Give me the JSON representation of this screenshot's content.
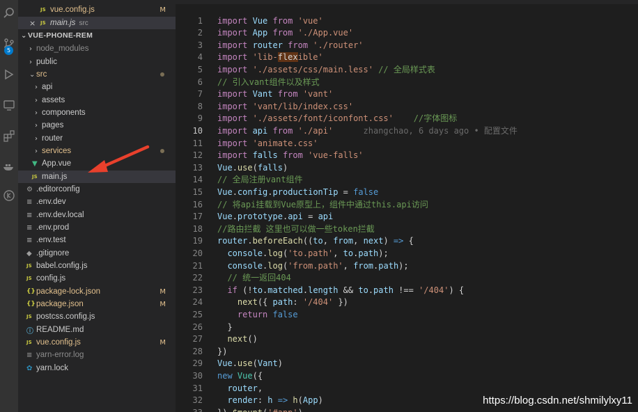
{
  "sidebar": {
    "open_editors": [
      {
        "name": "vue.config.js",
        "badge": "M"
      },
      {
        "name": "main.js",
        "folder": "src",
        "close": "×"
      }
    ],
    "project_title": "VUE-PHONE-REM",
    "tree": [
      {
        "label": "node_modules"
      },
      {
        "label": "public"
      },
      {
        "label": "src"
      },
      {
        "label": "api"
      },
      {
        "label": "assets"
      },
      {
        "label": "components"
      },
      {
        "label": "pages"
      },
      {
        "label": "router"
      },
      {
        "label": "services"
      },
      {
        "label": "App.vue"
      },
      {
        "label": "main.js"
      },
      {
        "label": ".editorconfig"
      },
      {
        "label": ".env.dev"
      },
      {
        "label": ".env.dev.local"
      },
      {
        "label": ".env.prod"
      },
      {
        "label": ".env.test"
      },
      {
        "label": ".gitignore"
      },
      {
        "label": "babel.config.js"
      },
      {
        "label": "config.js"
      },
      {
        "label": "package-lock.json",
        "badge": "M"
      },
      {
        "label": "package.json",
        "badge": "M"
      },
      {
        "label": "postcss.config.js"
      },
      {
        "label": "README.md"
      },
      {
        "label": "vue.config.js",
        "badge": "M"
      },
      {
        "label": "yarn-error.log"
      },
      {
        "label": "yarn.lock"
      }
    ]
  },
  "activity": {
    "badge": "5"
  },
  "editor": {
    "lines": [
      [
        [
          "import ",
          "kw2"
        ],
        [
          "Vue ",
          "id"
        ],
        [
          "from ",
          "kw2"
        ],
        [
          "'vue'",
          "str"
        ]
      ],
      [
        [
          "import ",
          "kw2"
        ],
        [
          "App ",
          "id"
        ],
        [
          "from ",
          "kw2"
        ],
        [
          "'./App.vue'",
          "str"
        ]
      ],
      [
        [
          "import ",
          "kw2"
        ],
        [
          "router ",
          "id"
        ],
        [
          "from ",
          "kw2"
        ],
        [
          "'./router'",
          "str"
        ]
      ],
      [
        [
          "import ",
          "kw2"
        ],
        [
          "'lib-",
          "str"
        ],
        [
          "flex",
          "hl"
        ],
        [
          "ible'",
          "str"
        ]
      ],
      [
        [
          "import ",
          "kw2"
        ],
        [
          "'./assets/css/main.less'",
          "str"
        ],
        [
          " // 全局样式表",
          "cm"
        ]
      ],
      [
        [
          "// 引入vant组件以及样式",
          "cm"
        ]
      ],
      [
        [
          "import ",
          "kw2"
        ],
        [
          "Vant ",
          "id"
        ],
        [
          "from ",
          "kw2"
        ],
        [
          "'vant'",
          "str"
        ]
      ],
      [
        [
          "import ",
          "kw2"
        ],
        [
          "'vant/lib/index.css'",
          "str"
        ]
      ],
      [
        [
          "import ",
          "kw2"
        ],
        [
          "'./assets/font/iconfont.css'",
          "str"
        ],
        [
          "    //字体图标",
          "cm"
        ]
      ],
      [
        [
          "import ",
          "kw2"
        ],
        [
          "api ",
          "id"
        ],
        [
          "from ",
          "kw2"
        ],
        [
          "'./api'",
          "str"
        ],
        [
          "      zhangchao, 6 days ago • 配置文件",
          "blame"
        ]
      ],
      [
        [
          "import ",
          "kw2"
        ],
        [
          "'animate.css'",
          "str"
        ]
      ],
      [
        [
          "import ",
          "kw2"
        ],
        [
          "falls ",
          "id"
        ],
        [
          "from ",
          "kw2"
        ],
        [
          "'vue-falls'",
          "str"
        ]
      ],
      [
        [
          "Vue",
          "id"
        ],
        [
          ".",
          ""
        ],
        [
          "use",
          "fn"
        ],
        [
          "(",
          ""
        ],
        [
          "falls",
          "id"
        ],
        [
          ")",
          ""
        ]
      ],
      [
        [
          "// 全局注册vant组件",
          "cm"
        ]
      ],
      [
        [
          "Vue",
          "id"
        ],
        [
          ".",
          ""
        ],
        [
          "config",
          "id"
        ],
        [
          ".",
          ""
        ],
        [
          "productionTip",
          "id"
        ],
        [
          " = ",
          ""
        ],
        [
          "false",
          "kw"
        ]
      ],
      [
        [
          "// 将api挂载到Vue原型上，组件中通过this.api访问",
          "cm"
        ]
      ],
      [
        [
          "Vue",
          "id"
        ],
        [
          ".",
          ""
        ],
        [
          "prototype",
          "id"
        ],
        [
          ".",
          ""
        ],
        [
          "api",
          "id"
        ],
        [
          " = ",
          ""
        ],
        [
          "api",
          "id"
        ]
      ],
      [
        [
          "//路由拦截 这里也可以做一些token拦截",
          "cm"
        ]
      ],
      [
        [
          "router",
          "id"
        ],
        [
          ".",
          ""
        ],
        [
          "beforeEach",
          "fn"
        ],
        [
          "((",
          ""
        ],
        [
          "to",
          "id"
        ],
        [
          ", ",
          ""
        ],
        [
          "from",
          "id"
        ],
        [
          ", ",
          ""
        ],
        [
          "next",
          "id"
        ],
        [
          ") ",
          ""
        ],
        [
          "=>",
          "kw"
        ],
        [
          " {",
          ""
        ]
      ],
      [
        [
          "  ",
          ""
        ],
        [
          "console",
          "id"
        ],
        [
          ".",
          ""
        ],
        [
          "log",
          "fn"
        ],
        [
          "(",
          ""
        ],
        [
          "'to.path'",
          "str"
        ],
        [
          ", ",
          ""
        ],
        [
          "to",
          "id"
        ],
        [
          ".",
          ""
        ],
        [
          "path",
          "id"
        ],
        [
          ");",
          ""
        ]
      ],
      [
        [
          "  ",
          ""
        ],
        [
          "console",
          "id"
        ],
        [
          ".",
          ""
        ],
        [
          "log",
          "fn"
        ],
        [
          "(",
          ""
        ],
        [
          "'from.path'",
          "str"
        ],
        [
          ", ",
          ""
        ],
        [
          "from",
          "id"
        ],
        [
          ".",
          ""
        ],
        [
          "path",
          "id"
        ],
        [
          ");",
          ""
        ]
      ],
      [
        [
          "  // 统一返回404",
          "cm"
        ]
      ],
      [
        [
          "  ",
          ""
        ],
        [
          "if ",
          "kw2"
        ],
        [
          "(!",
          ""
        ],
        [
          "to",
          "id"
        ],
        [
          ".",
          ""
        ],
        [
          "matched",
          "id"
        ],
        [
          ".",
          ""
        ],
        [
          "length",
          "id"
        ],
        [
          " && ",
          ""
        ],
        [
          "to",
          "id"
        ],
        [
          ".",
          ""
        ],
        [
          "path",
          "id"
        ],
        [
          " !== ",
          ""
        ],
        [
          "'/404'",
          "str"
        ],
        [
          ") {",
          ""
        ]
      ],
      [
        [
          "    ",
          ""
        ],
        [
          "next",
          "fn"
        ],
        [
          "({ ",
          ""
        ],
        [
          "path",
          "id"
        ],
        [
          ": ",
          ""
        ],
        [
          "'/404'",
          "str"
        ],
        [
          " })",
          ""
        ]
      ],
      [
        [
          "    ",
          ""
        ],
        [
          "return ",
          "kw2"
        ],
        [
          "false",
          "kw"
        ]
      ],
      [
        [
          "  }",
          ""
        ]
      ],
      [
        [
          "  ",
          ""
        ],
        [
          "next",
          "fn"
        ],
        [
          "()",
          ""
        ]
      ],
      [
        [
          "})",
          ""
        ]
      ],
      [
        [
          "Vue",
          "id"
        ],
        [
          ".",
          ""
        ],
        [
          "use",
          "fn"
        ],
        [
          "(",
          ""
        ],
        [
          "Vant",
          "id"
        ],
        [
          ")",
          ""
        ]
      ],
      [
        [
          "new ",
          "kw"
        ],
        [
          "Vue",
          "cls"
        ],
        [
          "({",
          ""
        ]
      ],
      [
        [
          "  ",
          ""
        ],
        [
          "router",
          "id"
        ],
        [
          ",",
          ""
        ]
      ],
      [
        [
          "  ",
          ""
        ],
        [
          "render",
          "id"
        ],
        [
          ": ",
          ""
        ],
        [
          "h ",
          "id"
        ],
        [
          "=> ",
          "kw"
        ],
        [
          "h",
          "fn"
        ],
        [
          "(",
          ""
        ],
        [
          "App",
          "id"
        ],
        [
          ")",
          ""
        ]
      ],
      [
        [
          "}).",
          ""
        ],
        [
          "$mount",
          "fn"
        ],
        [
          "(",
          ""
        ],
        [
          "'#app'",
          "str"
        ],
        [
          ")",
          ""
        ]
      ]
    ]
  },
  "watermark": "https://blog.csdn.net/shmilylxy11"
}
